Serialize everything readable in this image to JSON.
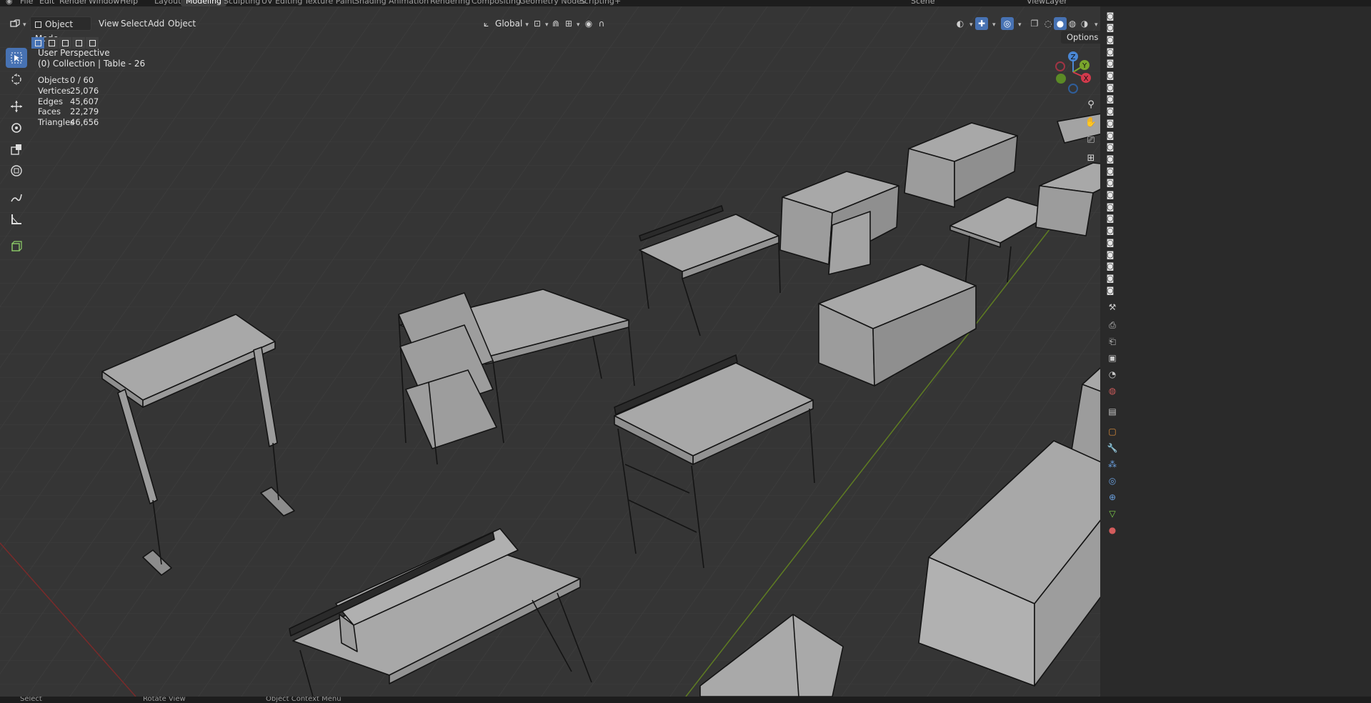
{
  "top_menu": {
    "items": [
      "File",
      "Edit",
      "Render",
      "Window",
      "Help"
    ],
    "workspaces": [
      "Layout",
      "Modeling",
      "Sculpting",
      "UV Editing",
      "Texture Paint",
      "Shading",
      "Animation",
      "Rendering",
      "Compositing",
      "Geometry Nodes",
      "Scripting"
    ],
    "active_workspace": "Modeling",
    "add_workspace": "+",
    "scene": "Scene",
    "view_layer": "ViewLayer"
  },
  "header": {
    "mode": "Object Mode",
    "menus": [
      "View",
      "Select",
      "Add",
      "Object"
    ],
    "transform_orientation": "Global",
    "options": "Options"
  },
  "overlay": {
    "view_name": "User Perspective",
    "collection": "(0) Collection | Table - 26"
  },
  "stats": [
    {
      "label": "Objects",
      "value": "0 / 60"
    },
    {
      "label": "Vertices",
      "value": "25,076"
    },
    {
      "label": "Edges",
      "value": "45,607"
    },
    {
      "label": "Faces",
      "value": "22,279"
    },
    {
      "label": "Triangles",
      "value": "46,656"
    }
  ],
  "gizmo": {
    "z": "Z",
    "y": "Y",
    "x": "X"
  },
  "toolbar": {
    "tools": [
      "select-box",
      "cursor",
      "move",
      "rotate",
      "scale",
      "transform",
      "annotate",
      "measure",
      "add-cube"
    ],
    "active": "select-box"
  },
  "status_bar": {
    "left": "Select",
    "middle": "Rotate View",
    "right": "Object Context Menu"
  },
  "colors": {
    "viewport_bg": "#353535",
    "grid": "#3c3c3c",
    "x_axis": "#7a2a2a",
    "y_axis": "#5f7d22",
    "accent": "#4772b3",
    "mesh_face": "#a9a9a9",
    "mesh_edge": "#161616"
  }
}
